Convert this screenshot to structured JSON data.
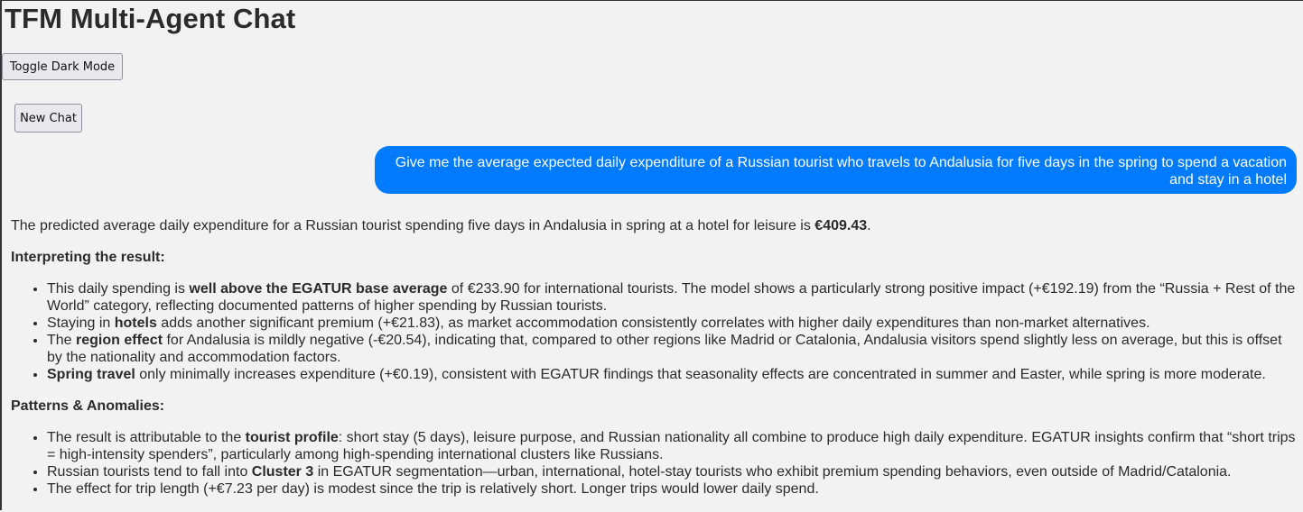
{
  "app": {
    "title": "TFM Multi-Agent Chat",
    "toggle_label": "Toggle Dark Mode",
    "new_chat_label": "New Chat"
  },
  "colors": {
    "accent": "#007bff",
    "background": "#f2f2f2"
  },
  "user_message": "Give me the average expected daily expenditure of a Russian tourist who travels to Andalusia for five days in the spring to spend a vacation and stay in a hotel",
  "assistant": {
    "lead": {
      "text": "The predicted average daily expenditure for a Russian tourist spending five days in Andalusia in spring at a hotel for leisure is ",
      "value": "€409.43",
      "end": "."
    },
    "section1_title": "Interpreting the result:",
    "section1_items": [
      {
        "pre": "This daily spending is ",
        "bold": "well above the EGATUR base average",
        "post": " of €233.90 for international tourists. The model shows a particularly strong positive impact (+€192.19) from the “Russia + Rest of the World” category, reflecting documented patterns of higher spending by Russian tourists."
      },
      {
        "pre": "Staying in ",
        "bold": "hotels",
        "post": " adds another significant premium (+€21.83), as market accommodation consistently correlates with higher daily expenditures than non-market alternatives."
      },
      {
        "pre": "The ",
        "bold": "region effect",
        "post": " for Andalusia is mildly negative (-€20.54), indicating that, compared to other regions like Madrid or Catalonia, Andalusia visitors spend slightly less on average, but this is offset by the nationality and accommodation factors."
      },
      {
        "pre": "",
        "bold": "Spring travel",
        "post": " only minimally increases expenditure (+€0.19), consistent with EGATUR findings that seasonality effects are concentrated in summer and Easter, while spring is more moderate."
      }
    ],
    "section2_title": "Patterns & Anomalies:",
    "section2_items": [
      {
        "pre": "The result is attributable to the ",
        "bold": "tourist profile",
        "post": ": short stay (5 days), leisure purpose, and Russian nationality all combine to produce high daily expenditure. EGATUR insights confirm that “short trips = high-intensity spenders”, particularly among high-spending international clusters like Russians."
      },
      {
        "pre": "Russian tourists tend to fall into ",
        "bold": "Cluster 3",
        "post": " in EGATUR segmentation—urban, international, hotel-stay tourists who exhibit premium spending behaviors, even outside of Madrid/Catalonia."
      },
      {
        "pre": "The effect for trip length (+€7.23 per day) is modest since the trip is relatively short. Longer trips would lower daily spend.",
        "bold": "",
        "post": ""
      }
    ]
  }
}
